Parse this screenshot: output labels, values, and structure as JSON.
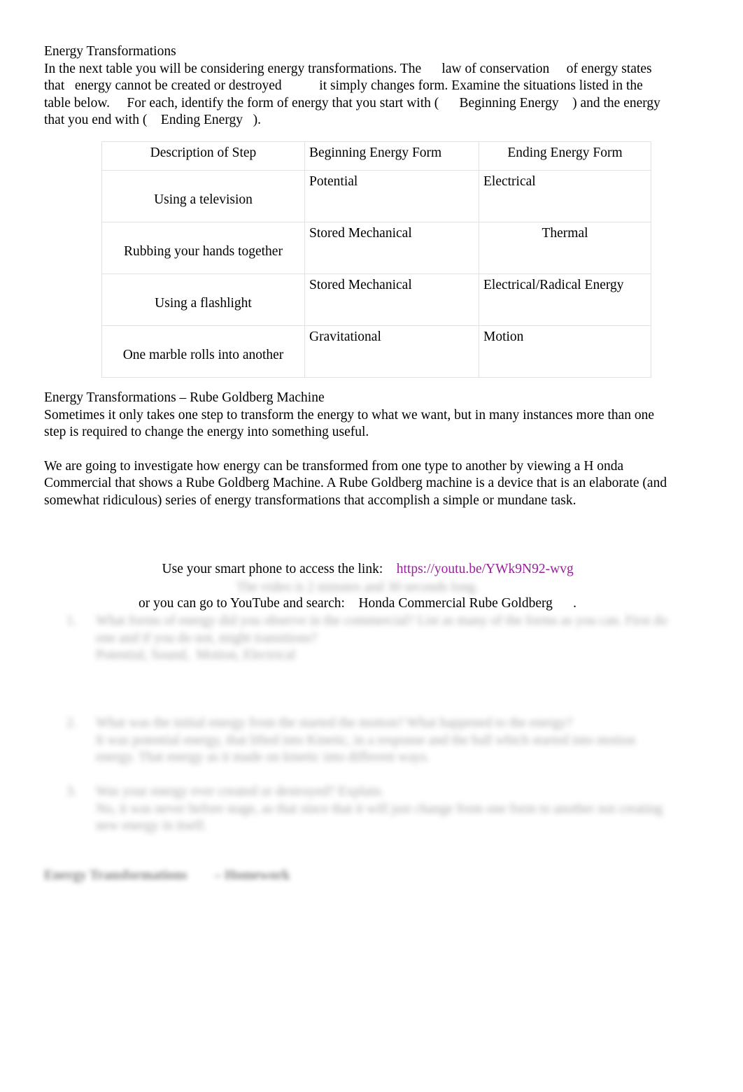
{
  "document": {
    "intro": {
      "title": "Energy Transformations",
      "body": "In the next table you will be considering energy transformations. The      law of conservation     of energy states that   energy cannot be created or destroyed           it simply changes form. Examine the situations listed in the table below.     For each, identify the form of energy that you start with (      Beginning Energy    ) and the energy that you end with (    Ending Energy   )."
    },
    "table": {
      "headers": {
        "description": "Description of Step",
        "beginning": " Beginning Energy Form",
        "ending": "Ending Energy Form"
      },
      "rows": [
        {
          "description": "Using a television",
          "beginning": "Potential",
          "ending": "Electrical"
        },
        {
          "description": "Rubbing your hands together",
          "beginning": "Stored Mechanical",
          "ending": "Thermal"
        },
        {
          "description": "Using a flashlight",
          "beginning": "Stored Mechanical",
          "ending": "Electrical/Radical Energy"
        },
        {
          "description": "One marble rolls into another",
          "beginning": "Gravitational",
          "ending": "Motion"
        }
      ]
    },
    "rube": {
      "title": "Energy Transformations        – Rube Goldberg Machine",
      "para1": "Sometimes it only takes one step to transform the energy to what we want, but in many instances more than one step is required to change the energy into something useful.",
      "para2": "We are going to investigate how energy can be transformed from one type to another by viewing a H onda Commercial that shows a Rube Goldberg Machine. A Rube Goldberg machine is a device that is an elaborate (and somewhat ridiculous) series of energy transformations that accomplish a simple or mundane task."
    },
    "link_block": {
      "line1_prefix": "Use your smart phone to access the link:    ",
      "url_text": "https://youtu.be/YWk9N92-wvg",
      "line2": "or you can go to YouTube and search:    Honda Commercial Rube Goldberg      .",
      "line3_obscured": "The video is 2 minutes and 30 seconds long."
    },
    "questions": [
      {
        "number": "1.",
        "prompt_obscured": "What forms of energy did you observe in the commercial? List as many of the forms as you can. First do one and if you do not, might transitions?",
        "answer_obscured": "Potential, Sound,  Motion, Electrical"
      },
      {
        "number": "2.",
        "prompt_obscured": "What was the initial energy from the started the motion? What happened to the energy?",
        "answer_obscured": "It was potential energy, that lifted into Kinetic, in a response and the ball which started into motion energy. That energy as it made on kinetic into different ways."
      },
      {
        "number": "3.",
        "prompt_obscured": "Was your energy ever created or destroyed? Explain.",
        "answer_obscured": "No, it was never before stage, as that since that it will just change from one form to another not creating new energy in itself."
      }
    ],
    "homework_heading_obscured": "Energy Transformations        – Homework"
  }
}
